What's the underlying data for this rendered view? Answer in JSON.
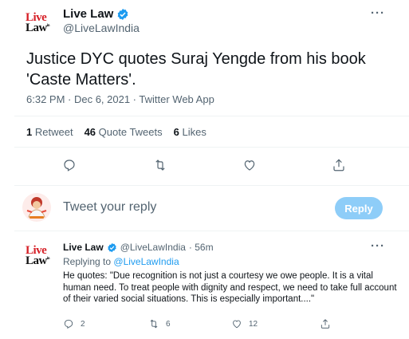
{
  "tweet": {
    "logo_line1": "Live",
    "logo_line2": "Law",
    "logo_mark": "in",
    "author_name": "Live Law",
    "author_handle": "@LiveLawIndia",
    "text": "Justice DYC quotes Suraj Yengde from his book 'Caste Matters'.",
    "meta": "6:32 PM · Dec 6, 2021 · Twitter Web App",
    "more_label": "···"
  },
  "stats": {
    "retweets_count": "1",
    "retweets_label": "Retweet",
    "quotes_count": "46",
    "quotes_label": "Quote Tweets",
    "likes_count": "6",
    "likes_label": "Likes"
  },
  "composer": {
    "placeholder": "Tweet your reply",
    "button_label": "Reply"
  },
  "reply": {
    "author_name": "Live Law",
    "author_handle": "@LiveLawIndia",
    "time": "· 56m",
    "replying_prefix": "Replying to",
    "replying_to": "@LiveLawIndia",
    "text": "He quotes: \"Due recognition is not just a courtesy we owe people. It is a vital human need. To treat people with dignity and respect, we need to take full account of their varied social situations. This is especially important....\"",
    "reply_count": "2",
    "retweet_count": "6",
    "like_count": "12",
    "more_label": "···"
  },
  "colors": {
    "brand_red": "#d61f26",
    "verified_blue": "#1d9bf0",
    "reply_button": "#8ecdf8",
    "muted": "#536471"
  },
  "icons": [
    "verified-badge-icon",
    "reply-icon",
    "retweet-icon",
    "like-icon",
    "share-icon",
    "more-icon"
  ]
}
